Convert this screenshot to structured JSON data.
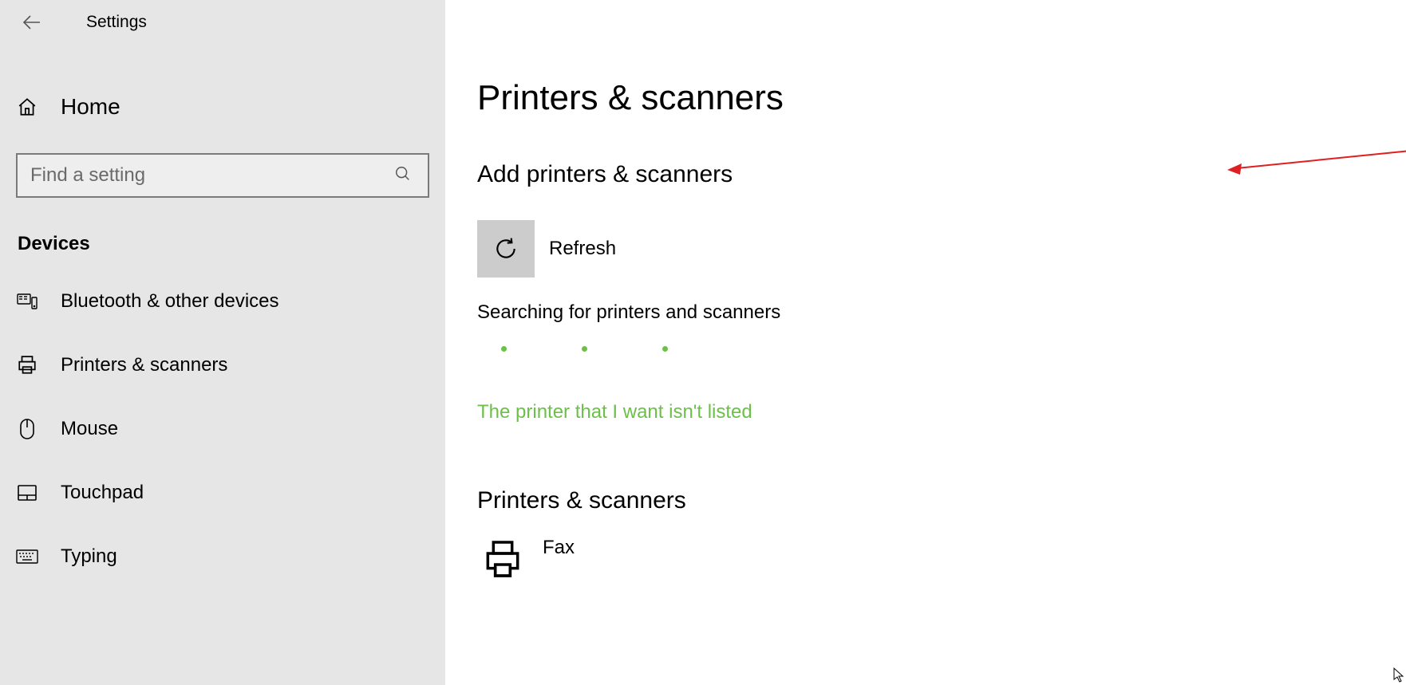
{
  "header": {
    "title": "Settings"
  },
  "sidebar": {
    "home_label": "Home",
    "search_placeholder": "Find a setting",
    "category_label": "Devices",
    "items": [
      {
        "label": "Bluetooth & other devices"
      },
      {
        "label": "Printers & scanners"
      },
      {
        "label": "Mouse"
      },
      {
        "label": "Touchpad"
      },
      {
        "label": "Typing"
      }
    ]
  },
  "main": {
    "page_title": "Printers & scanners",
    "add_section_title": "Add printers & scanners",
    "refresh_label": "Refresh",
    "searching_text": "Searching for printers and scanners",
    "not_listed_link": "The printer that I want isn't listed",
    "printers_section_title": "Printers & scanners",
    "devices": [
      {
        "label": "Fax"
      }
    ]
  },
  "colors": {
    "accent_green": "#6cc04a",
    "sidebar_bg": "#e6e6e6",
    "tile_grey": "#cccccc",
    "arrow_red": "#e02020"
  }
}
